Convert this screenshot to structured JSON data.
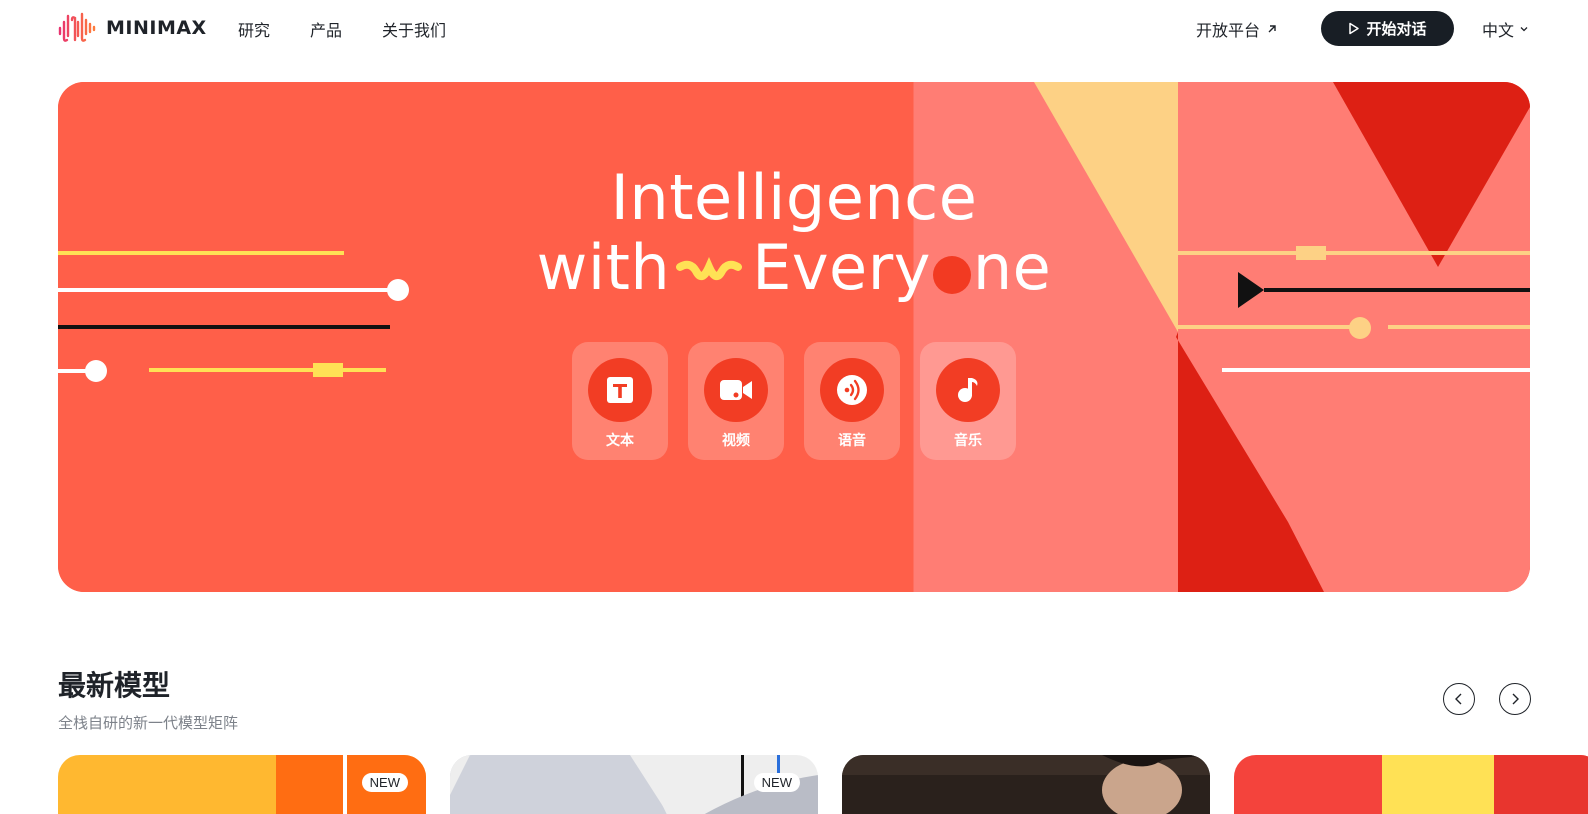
{
  "header": {
    "brand": "MINIMAX",
    "nav": [
      "研究",
      "产品",
      "关于我们"
    ],
    "open_platform": "开放平台",
    "open_platform_icon": "external-arrow-icon",
    "start_button": "开始对话",
    "start_icon": "play-icon",
    "language": "中文"
  },
  "hero": {
    "title_line1": "Intelligence",
    "title_line2_a": "with",
    "title_line2_b": "Every",
    "title_line2_c": "ne",
    "tiles": [
      {
        "label": "文本",
        "icon": "text-icon"
      },
      {
        "label": "视频",
        "icon": "video-camera-icon"
      },
      {
        "label": "语音",
        "icon": "voice-icon"
      },
      {
        "label": "音乐",
        "icon": "music-note-icon"
      }
    ],
    "colors": {
      "primary": "#ff5f49",
      "accent": "#f23d24",
      "yellow": "#ffe155",
      "pink": "#ff7d74",
      "dark_red": "#dd2014"
    }
  },
  "models": {
    "title": "最新模型",
    "subtitle": "全栈自研的新一代模型矩阵",
    "prev_icon": "chevron-left-icon",
    "next_icon": "chevron-right-icon",
    "cards": [
      {
        "badge": "NEW"
      },
      {
        "badge": "NEW"
      },
      {
        "badge": ""
      },
      {
        "badge": ""
      }
    ]
  }
}
